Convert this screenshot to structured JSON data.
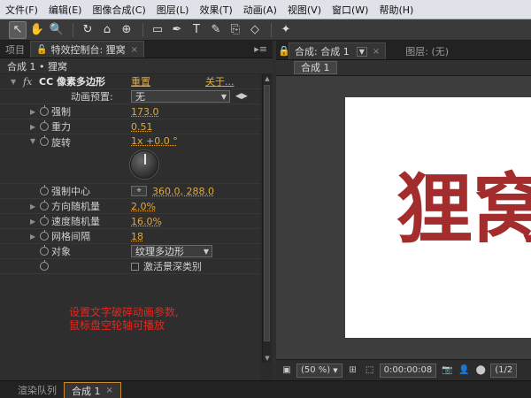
{
  "menubar": {
    "items": [
      "文件(F)",
      "编辑(E)",
      "图像合成(C)",
      "图层(L)",
      "效果(T)",
      "动画(A)",
      "视图(V)",
      "窗口(W)",
      "帮助(H)"
    ]
  },
  "toolbar": {
    "tools": [
      "selection-icon",
      "hand-icon",
      "zoom-icon",
      "rotate-icon",
      "camera-icon",
      "pan-behind-icon",
      "rectangle-icon",
      "pen-icon",
      "text-icon",
      "brush-icon",
      "clone-stamp-icon",
      "eraser-icon",
      "puppet-pin-icon"
    ],
    "tool_glyphs": [
      "↖",
      "✋",
      "🔍",
      "↻",
      "⌂",
      "⊕",
      "▭",
      "✒",
      "T",
      "✎",
      "⎘",
      "◇",
      "✦"
    ]
  },
  "left_panel": {
    "tabs": [
      {
        "label": "项目",
        "active": false
      },
      {
        "label": "特效控制台: 狸窝",
        "active": true
      }
    ],
    "header": "合成 1 • 狸窝",
    "effect": {
      "fx": "fx",
      "name": "CC 像素多边形",
      "reset": "重置",
      "about": "关于..."
    },
    "preset": {
      "label": "动画预置:",
      "value": "无"
    },
    "properties": [
      {
        "label": "强制",
        "value": "173.0"
      },
      {
        "label": "重力",
        "value": "0.51"
      },
      {
        "label": "旋转",
        "value": "1x +0.0 °"
      },
      {
        "label": "强制中心",
        "value": "360.0, 288.0"
      },
      {
        "label": "方向随机量",
        "value": "2.0%"
      },
      {
        "label": "速度随机量",
        "value": "16.0%"
      },
      {
        "label": "网格间隔",
        "value": "18"
      },
      {
        "label": "对象",
        "value": "纹理多边形"
      },
      {
        "label": "",
        "value": "激活景深类别"
      }
    ],
    "annotation": [
      "设置文字破碎动画参数,",
      "鼠标盘空轮轴可播放"
    ]
  },
  "right_panel": {
    "tabs": [
      {
        "label": "合成: 合成 1",
        "active": true
      },
      {
        "label": "图层: (无)",
        "active": false
      }
    ],
    "subtab": "合成 1",
    "canvas_text": "狸窝",
    "zoom": "(50 %)",
    "timecode": "0:00:00:08",
    "resolution": "(1/2"
  },
  "bottom_tabs": [
    {
      "label": "渲染队列",
      "active": false
    },
    {
      "label": "合成 1",
      "active": true
    }
  ]
}
